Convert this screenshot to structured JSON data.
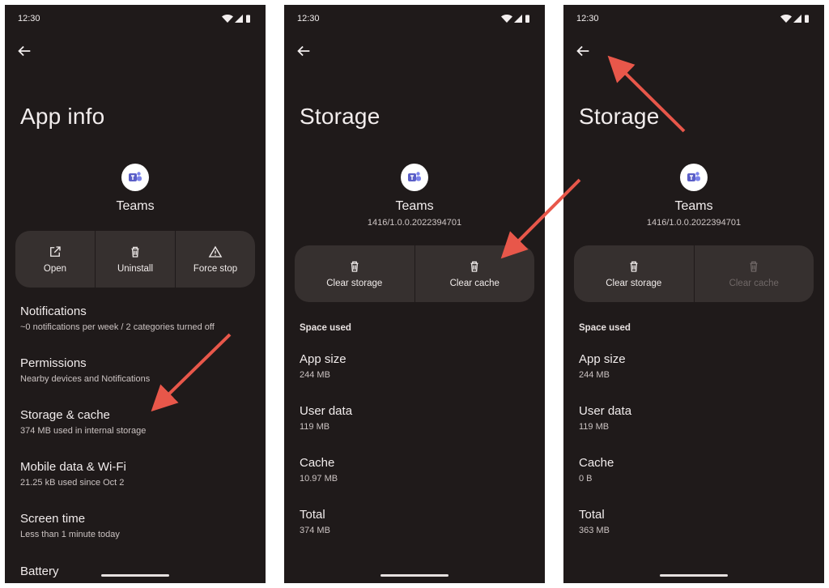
{
  "colors": {
    "background": "#1f1a1a",
    "button_group": "#36302f",
    "arrow": "#e8574a"
  },
  "screens": [
    {
      "status": {
        "time": "12:30"
      },
      "title": "App info",
      "app_name": "Teams",
      "actions": [
        {
          "label": "Open",
          "icon": "open-external-icon"
        },
        {
          "label": "Uninstall",
          "icon": "trash-icon"
        },
        {
          "label": "Force stop",
          "icon": "warning-icon"
        }
      ],
      "items": [
        {
          "title": "Notifications",
          "subtitle": "~0 notifications per week / 2 categories turned off"
        },
        {
          "title": "Permissions",
          "subtitle": "Nearby devices and Notifications"
        },
        {
          "title": "Storage & cache",
          "subtitle": "374 MB used in internal storage"
        },
        {
          "title": "Mobile data & Wi-Fi",
          "subtitle": "21.25 kB used since Oct 2"
        },
        {
          "title": "Screen time",
          "subtitle": "Less than 1 minute today"
        },
        {
          "title": "Battery",
          "subtitle": ""
        }
      ]
    },
    {
      "status": {
        "time": "12:30"
      },
      "title": "Storage",
      "app_name": "Teams",
      "version": "1416/1.0.0.2022394701",
      "actions": [
        {
          "label": "Clear storage",
          "icon": "trash-icon"
        },
        {
          "label": "Clear cache",
          "icon": "trash-icon"
        }
      ],
      "section": "Space used",
      "items": [
        {
          "title": "App size",
          "subtitle": "244 MB"
        },
        {
          "title": "User data",
          "subtitle": "119 MB"
        },
        {
          "title": "Cache",
          "subtitle": "10.97 MB"
        },
        {
          "title": "Total",
          "subtitle": "374 MB"
        }
      ]
    },
    {
      "status": {
        "time": "12:30"
      },
      "title": "Storage",
      "app_name": "Teams",
      "version": "1416/1.0.0.2022394701",
      "actions": [
        {
          "label": "Clear storage",
          "icon": "trash-icon"
        },
        {
          "label": "Clear cache",
          "icon": "trash-icon",
          "disabled": true
        }
      ],
      "section": "Space used",
      "items": [
        {
          "title": "App size",
          "subtitle": "244 MB"
        },
        {
          "title": "User data",
          "subtitle": "119 MB"
        },
        {
          "title": "Cache",
          "subtitle": "0 B"
        },
        {
          "title": "Total",
          "subtitle": "363 MB"
        }
      ]
    }
  ]
}
